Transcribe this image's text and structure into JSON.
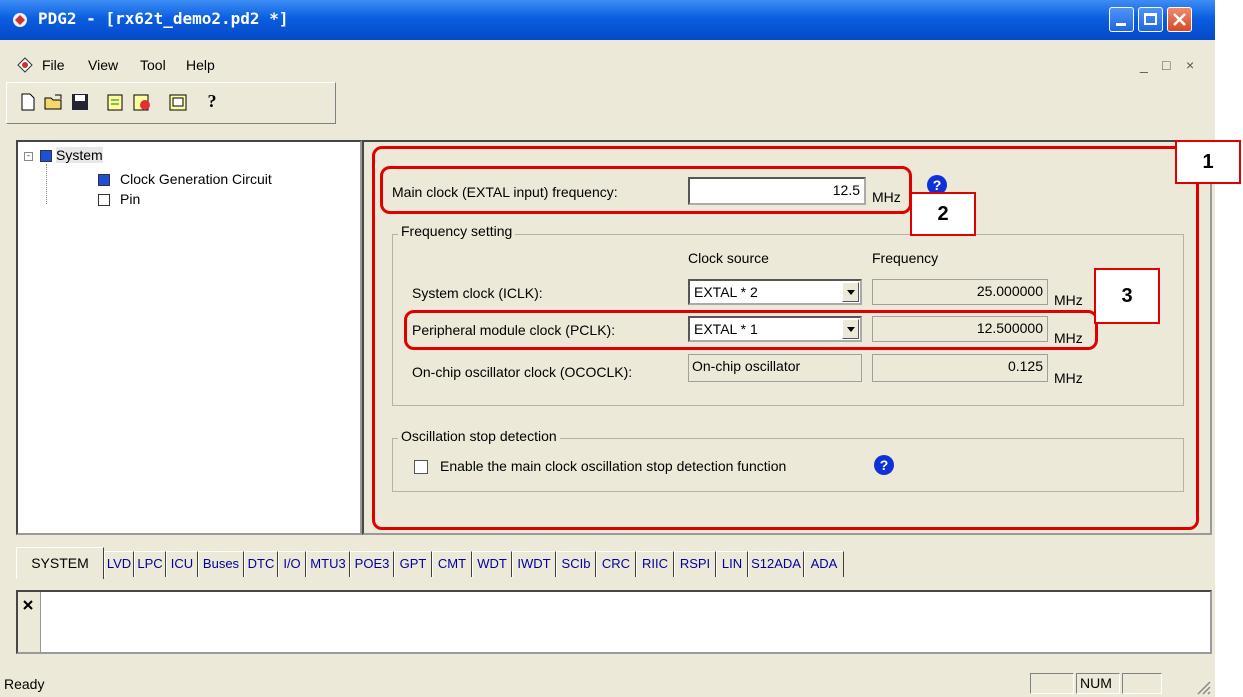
{
  "window": {
    "title": "PDG2 - [rx62t_demo2.pd2 *]",
    "colors": {
      "titlebar": "#0a5fe0",
      "face": "#ece9d8",
      "annotation": "#e00000"
    }
  },
  "menu": {
    "items": [
      {
        "label": "File"
      },
      {
        "label": "View"
      },
      {
        "label": "Tool"
      },
      {
        "label": "Help"
      }
    ],
    "mdi_controls": [
      "_",
      "□",
      "×"
    ]
  },
  "toolbar": {
    "buttons": [
      "new-file-icon",
      "open-folder-icon",
      "save-icon",
      "generate-icon",
      "check-icon",
      "report-icon",
      "help-icon"
    ],
    "help_glyph": "?"
  },
  "tree": {
    "root": "System",
    "children": [
      "Clock Generation Circuit",
      "Pin"
    ]
  },
  "settings": {
    "main_clock_label": "Main clock (EXTAL input) frequency:",
    "main_clock_value": "12.5",
    "unit": "MHz",
    "help_glyph": "?",
    "frequency_group_title": "Frequency setting",
    "col_clock_source": "Clock source",
    "col_frequency": "Frequency",
    "rows": [
      {
        "label": "System clock (ICLK):",
        "source": "EXTAL * 2",
        "frequency": "25.000000",
        "unit": "MHz"
      },
      {
        "label": "Peripheral module clock (PCLK):",
        "source": "EXTAL * 1",
        "frequency": "12.500000",
        "unit": "MHz"
      },
      {
        "label": "On-chip oscillator clock (OCOCLK):",
        "source": "On-chip oscillator",
        "frequency": "0.125",
        "unit": "MHz"
      }
    ],
    "osc_group_title": "Oscillation stop detection",
    "osc_checkbox_label": "Enable the main clock oscillation stop detection function",
    "osc_checkbox_checked": false
  },
  "annotations": [
    "1",
    "2",
    "3"
  ],
  "tabs": [
    {
      "label": "SYSTEM",
      "active": true
    },
    {
      "label": "LVD"
    },
    {
      "label": "LPC"
    },
    {
      "label": "ICU"
    },
    {
      "label": "Buses"
    },
    {
      "label": "DTC"
    },
    {
      "label": "I/O"
    },
    {
      "label": "MTU3"
    },
    {
      "label": "POE3"
    },
    {
      "label": "GPT"
    },
    {
      "label": "CMT"
    },
    {
      "label": "WDT"
    },
    {
      "label": "IWDT"
    },
    {
      "label": "SCIb"
    },
    {
      "label": "CRC"
    },
    {
      "label": "RIIC"
    },
    {
      "label": "RSPI"
    },
    {
      "label": "LIN"
    },
    {
      "label": "S12ADA"
    },
    {
      "label": "ADA"
    }
  ],
  "status": {
    "text": "Ready",
    "num": "NUM"
  }
}
